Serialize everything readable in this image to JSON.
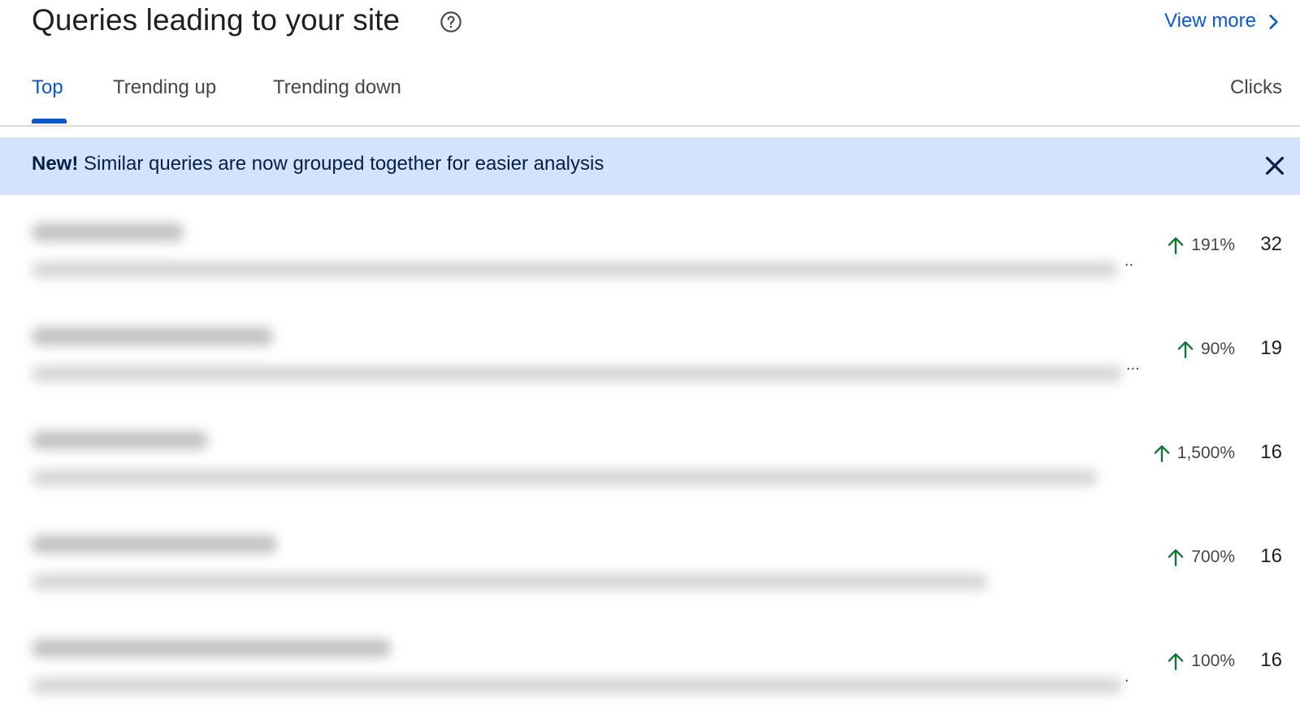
{
  "header": {
    "title": "Queries leading to your site",
    "view_more": "View more"
  },
  "tabs": [
    {
      "label": "Top",
      "active": true
    },
    {
      "label": "Trending up",
      "active": false
    },
    {
      "label": "Trending down",
      "active": false
    }
  ],
  "column_header": "Clicks",
  "banner": {
    "bold": "New!",
    "text": " Similar queries are now grouped together for easier analysis"
  },
  "rows": [
    {
      "trend": "191%",
      "clicks": "32",
      "ellipsis": ".."
    },
    {
      "trend": "90%",
      "clicks": "19",
      "ellipsis": "..."
    },
    {
      "trend": "1,500%",
      "clicks": "16",
      "ellipsis": ""
    },
    {
      "trend": "700%",
      "clicks": "16",
      "ellipsis": ""
    },
    {
      "trend": "100%",
      "clicks": "16",
      "ellipsis": "."
    }
  ],
  "colors": {
    "accent": "#0b57d0",
    "banner_bg": "#d3e3fd",
    "trend_up": "#137333"
  },
  "icons": {
    "help": "help-circle-icon",
    "chevron": "chevron-right-icon",
    "close": "close-icon",
    "trend": "arrow-up-icon"
  }
}
